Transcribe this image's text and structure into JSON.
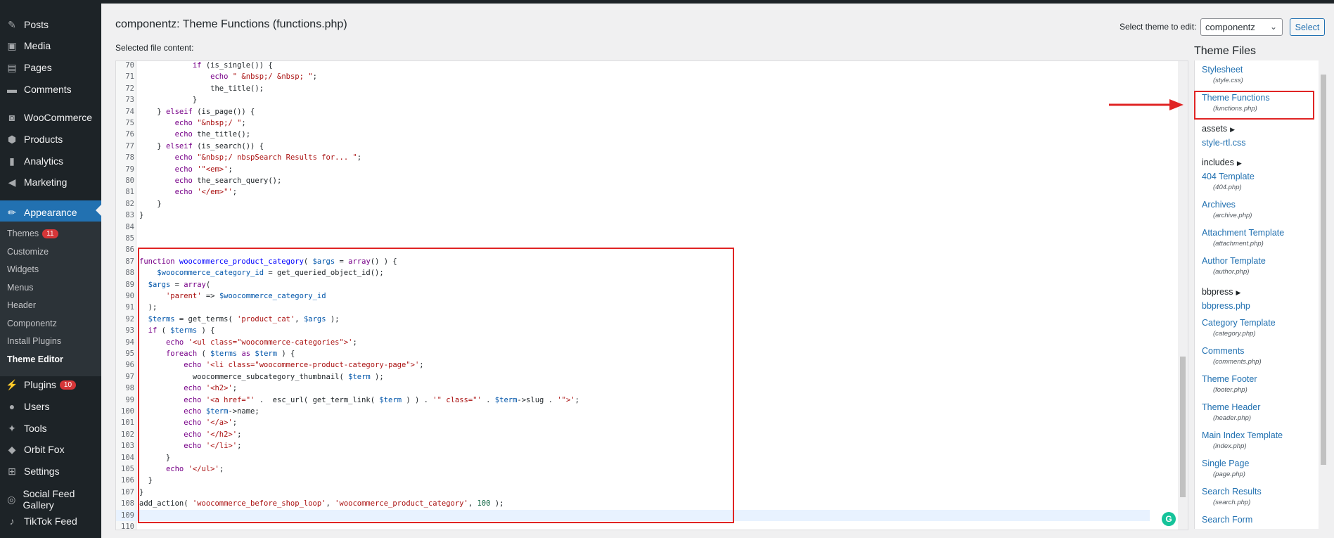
{
  "page": {
    "file_title": "componentz: Theme Functions (functions.php)",
    "selected_label": "Selected file content:",
    "theme_select_label": "Select theme to edit:",
    "theme_select_value": "componentz",
    "select_button": "Select"
  },
  "sidebar": {
    "items": [
      {
        "label": "Posts",
        "icon": "pin-icon"
      },
      {
        "label": "Media",
        "icon": "media-icon"
      },
      {
        "label": "Pages",
        "icon": "pages-icon"
      },
      {
        "label": "Comments",
        "icon": "comment-icon"
      },
      {
        "label": "WooCommerce",
        "icon": "woo-icon"
      },
      {
        "label": "Products",
        "icon": "products-icon"
      },
      {
        "label": "Analytics",
        "icon": "chart-icon"
      },
      {
        "label": "Marketing",
        "icon": "megaphone-icon"
      },
      {
        "label": "Appearance",
        "icon": "brush-icon"
      }
    ],
    "submenu": [
      {
        "label": "Themes",
        "badge": "11"
      },
      {
        "label": "Customize"
      },
      {
        "label": "Widgets"
      },
      {
        "label": "Menus"
      },
      {
        "label": "Header"
      },
      {
        "label": "Componentz"
      },
      {
        "label": "Install Plugins"
      },
      {
        "label": "Theme Editor"
      }
    ],
    "lower": [
      {
        "label": "Plugins",
        "badge": "10",
        "icon": "plug-icon"
      },
      {
        "label": "Users",
        "icon": "users-icon"
      },
      {
        "label": "Tools",
        "icon": "wrench-icon"
      },
      {
        "label": "Orbit Fox",
        "icon": "fox-icon"
      },
      {
        "label": "Settings",
        "icon": "settings-icon"
      },
      {
        "label": "Social Feed Gallery",
        "icon": "instagram-icon"
      },
      {
        "label": "TikTok Feed",
        "icon": "tiktok-icon"
      }
    ]
  },
  "code": {
    "lines": [
      {
        "n": "70",
        "html": "            <span class='kw'>if</span> (is_single()) {"
      },
      {
        "n": "71",
        "html": "                <span class='kw'>echo</span> <span class='str'>\" &amp;nbsp;/ &amp;nbsp; \"</span>;"
      },
      {
        "n": "72",
        "html": "                the_title();"
      },
      {
        "n": "73",
        "html": "            }"
      },
      {
        "n": "74",
        "html": "    } <span class='kw'>elseif</span> (is_page()) {"
      },
      {
        "n": "75",
        "html": "        <span class='kw'>echo</span> <span class='str'>\"&amp;nbsp;/ \"</span>;"
      },
      {
        "n": "76",
        "html": "        <span class='kw'>echo</span> the_title();"
      },
      {
        "n": "77",
        "html": "    } <span class='kw'>elseif</span> (is_search()) {"
      },
      {
        "n": "78",
        "html": "        <span class='kw'>echo</span> <span class='str'>\"&amp;nbsp;/ nbspSearch Results for... \"</span>;"
      },
      {
        "n": "79",
        "html": "        <span class='kw'>echo</span> <span class='str'>'\"&lt;em&gt;'</span>;"
      },
      {
        "n": "80",
        "html": "        <span class='kw'>echo</span> the_search_query();"
      },
      {
        "n": "81",
        "html": "        <span class='kw'>echo</span> <span class='str'>'&lt;/em&gt;\"'</span>;"
      },
      {
        "n": "82",
        "html": "    }"
      },
      {
        "n": "83",
        "html": "}"
      },
      {
        "n": "84",
        "html": ""
      },
      {
        "n": "85",
        "html": ""
      },
      {
        "n": "86",
        "html": ""
      },
      {
        "n": "87",
        "html": "<span class='kw'>function</span> <span class='fn'>woocommerce_product_category</span>( <span class='var'>$args</span> = <span class='kw'>array</span>() ) {"
      },
      {
        "n": "88",
        "html": "    <span class='var'>$woocommerce_category_id</span> = get_queried_object_id();"
      },
      {
        "n": "89",
        "html": "  <span class='var'>$args</span> = <span class='kw'>array</span>("
      },
      {
        "n": "90",
        "html": "      <span class='str'>'parent'</span> =&gt; <span class='var'>$woocommerce_category_id</span>"
      },
      {
        "n": "91",
        "html": "  );"
      },
      {
        "n": "92",
        "html": "  <span class='var'>$terms</span> = get_terms( <span class='str'>'product_cat'</span>, <span class='var'>$args</span> );"
      },
      {
        "n": "93",
        "html": "  <span class='kw'>if</span> ( <span class='var'>$terms</span> ) {"
      },
      {
        "n": "94",
        "html": "      <span class='kw'>echo</span> <span class='str'>'&lt;ul class=\"woocommerce-categories\"&gt;'</span>;"
      },
      {
        "n": "95",
        "html": "      <span class='kw'>foreach</span> ( <span class='var'>$terms</span> <span class='kw'>as</span> <span class='var'>$term</span> ) {"
      },
      {
        "n": "96",
        "html": "          <span class='kw'>echo</span> <span class='str'>'&lt;li class=\"woocommerce-product-category-page\"&gt;'</span>;"
      },
      {
        "n": "97",
        "html": "            woocommerce_subcategory_thumbnail( <span class='var'>$term</span> );"
      },
      {
        "n": "98",
        "html": "          <span class='kw'>echo</span> <span class='str'>'&lt;h2&gt;'</span>;"
      },
      {
        "n": "99",
        "html": "          <span class='kw'>echo</span> <span class='str'>'&lt;a href=\"'</span> .  esc_url( get_term_link( <span class='var'>$term</span> ) ) . <span class='str'>'\" class=\"'</span> . <span class='var'>$term</span>-&gt;slug . <span class='str'>'\"&gt;'</span>;"
      },
      {
        "n": "100",
        "html": "          <span class='kw'>echo</span> <span class='var'>$term</span>-&gt;name;"
      },
      {
        "n": "101",
        "html": "          <span class='kw'>echo</span> <span class='str'>'&lt;/a&gt;'</span>;"
      },
      {
        "n": "102",
        "html": "          <span class='kw'>echo</span> <span class='str'>'&lt;/h2&gt;'</span>;"
      },
      {
        "n": "103",
        "html": "          <span class='kw'>echo</span> <span class='str'>'&lt;/li&gt;'</span>;"
      },
      {
        "n": "104",
        "html": "      }"
      },
      {
        "n": "105",
        "html": "      <span class='kw'>echo</span> <span class='str'>'&lt;/ul&gt;'</span>;"
      },
      {
        "n": "106",
        "html": "  }"
      },
      {
        "n": "107",
        "html": "}"
      },
      {
        "n": "108",
        "html": "add_action( <span class='str'>'woocommerce_before_shop_loop'</span>, <span class='str'>'woocommerce_product_category'</span>, <span class='num'>100</span> );"
      },
      {
        "n": "109",
        "html": ""
      },
      {
        "n": "110",
        "html": ""
      }
    ]
  },
  "theme_files": {
    "heading": "Theme Files",
    "entries": [
      {
        "type": "file",
        "label": "Stylesheet",
        "sub": "(style.css)"
      },
      {
        "type": "file",
        "label": "Theme Functions",
        "sub": "(functions.php)"
      },
      {
        "type": "folder",
        "label": "assets"
      },
      {
        "type": "file",
        "label": "style-rtl.css",
        "sub": ""
      },
      {
        "type": "folder",
        "label": "includes"
      },
      {
        "type": "file",
        "label": "404 Template",
        "sub": "(404.php)"
      },
      {
        "type": "file",
        "label": "Archives",
        "sub": "(archive.php)"
      },
      {
        "type": "file",
        "label": "Attachment Template",
        "sub": "(attachment.php)"
      },
      {
        "type": "file",
        "label": "Author Template",
        "sub": "(author.php)"
      },
      {
        "type": "folder",
        "label": "bbpress"
      },
      {
        "type": "file",
        "label": "bbpress.php",
        "sub": ""
      },
      {
        "type": "file",
        "label": "Category Template",
        "sub": "(category.php)"
      },
      {
        "type": "file",
        "label": "Comments",
        "sub": "(comments.php)"
      },
      {
        "type": "file",
        "label": "Theme Footer",
        "sub": "(footer.php)"
      },
      {
        "type": "file",
        "label": "Theme Header",
        "sub": "(header.php)"
      },
      {
        "type": "file",
        "label": "Main Index Template",
        "sub": "(index.php)"
      },
      {
        "type": "file",
        "label": "Single Page",
        "sub": "(page.php)"
      },
      {
        "type": "file",
        "label": "Search Results",
        "sub": "(search.php)"
      },
      {
        "type": "file",
        "label": "Search Form",
        "sub": ""
      }
    ]
  },
  "colors": {
    "sidebar_bg": "#1d2327",
    "accent": "#2271b1",
    "highlight": "#e02424"
  }
}
